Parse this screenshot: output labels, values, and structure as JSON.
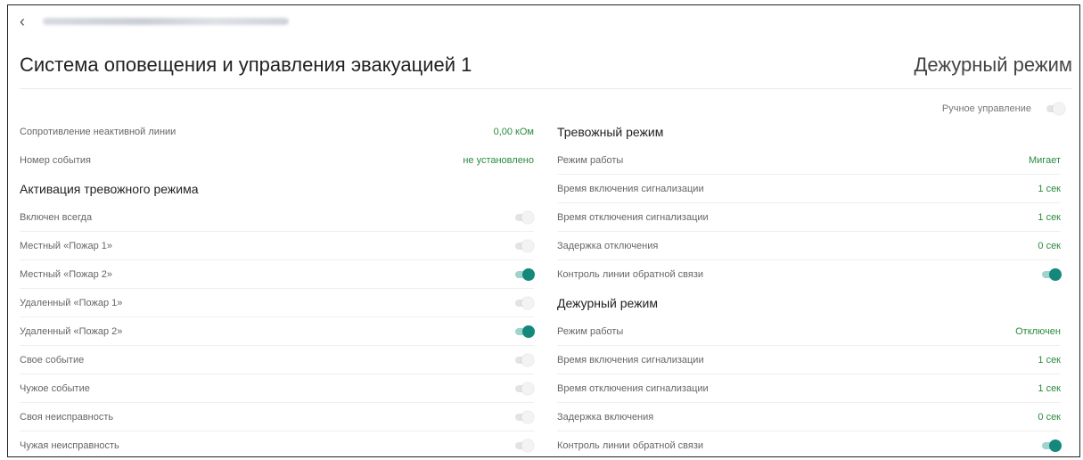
{
  "header": {
    "back_icon": "chevron-left-icon",
    "back_glyph": "‹",
    "page_title": "Система оповещения и управления эвакуацией 1",
    "mode_title": "Дежурный режим"
  },
  "manual_control": {
    "label": "Ручное управление",
    "on": false
  },
  "left": {
    "rows": [
      {
        "label": "Сопротивление неактивной линии",
        "value": "0,00 кОм"
      },
      {
        "label": "Номер события",
        "value": "не установлено"
      }
    ],
    "activation_title": "Активация тревожного режима",
    "toggles": [
      {
        "label": "Включен всегда",
        "on": false
      },
      {
        "label": "Местный «Пожар 1»",
        "on": false
      },
      {
        "label": "Местный «Пожар 2»",
        "on": true
      },
      {
        "label": "Удаленный «Пожар 1»",
        "on": false
      },
      {
        "label": "Удаленный «Пожар 2»",
        "on": true
      },
      {
        "label": "Свое событие",
        "on": false
      },
      {
        "label": "Чужое событие",
        "on": false
      },
      {
        "label": "Своя неисправность",
        "on": false
      },
      {
        "label": "Чужая неисправность",
        "on": false
      }
    ]
  },
  "alarm": {
    "title": "Тревожный режим",
    "rows": [
      {
        "label": "Режим работы",
        "value": "Мигает"
      },
      {
        "label": "Время включения сигнализации",
        "value": "1 сек"
      },
      {
        "label": "Время отключения сигнализации",
        "value": "1 сек"
      },
      {
        "label": "Задержка отключения",
        "value": "0 сек"
      }
    ],
    "feedback": {
      "label": "Контроль линии обратной связи",
      "on": true
    }
  },
  "duty": {
    "title": "Дежурный режим",
    "rows": [
      {
        "label": "Режим работы",
        "value": "Отключен"
      },
      {
        "label": "Время включения сигнализации",
        "value": "1 сек"
      },
      {
        "label": "Время отключения сигнализации",
        "value": "1 сек"
      },
      {
        "label": "Задержка включения",
        "value": "0 сек"
      }
    ],
    "feedback": {
      "label": "Контроль линии обратной связи",
      "on": true
    }
  },
  "colors": {
    "accent": "#14897b",
    "value_text": "#2b8a3e",
    "toggle_off": "#e3e3e3"
  }
}
